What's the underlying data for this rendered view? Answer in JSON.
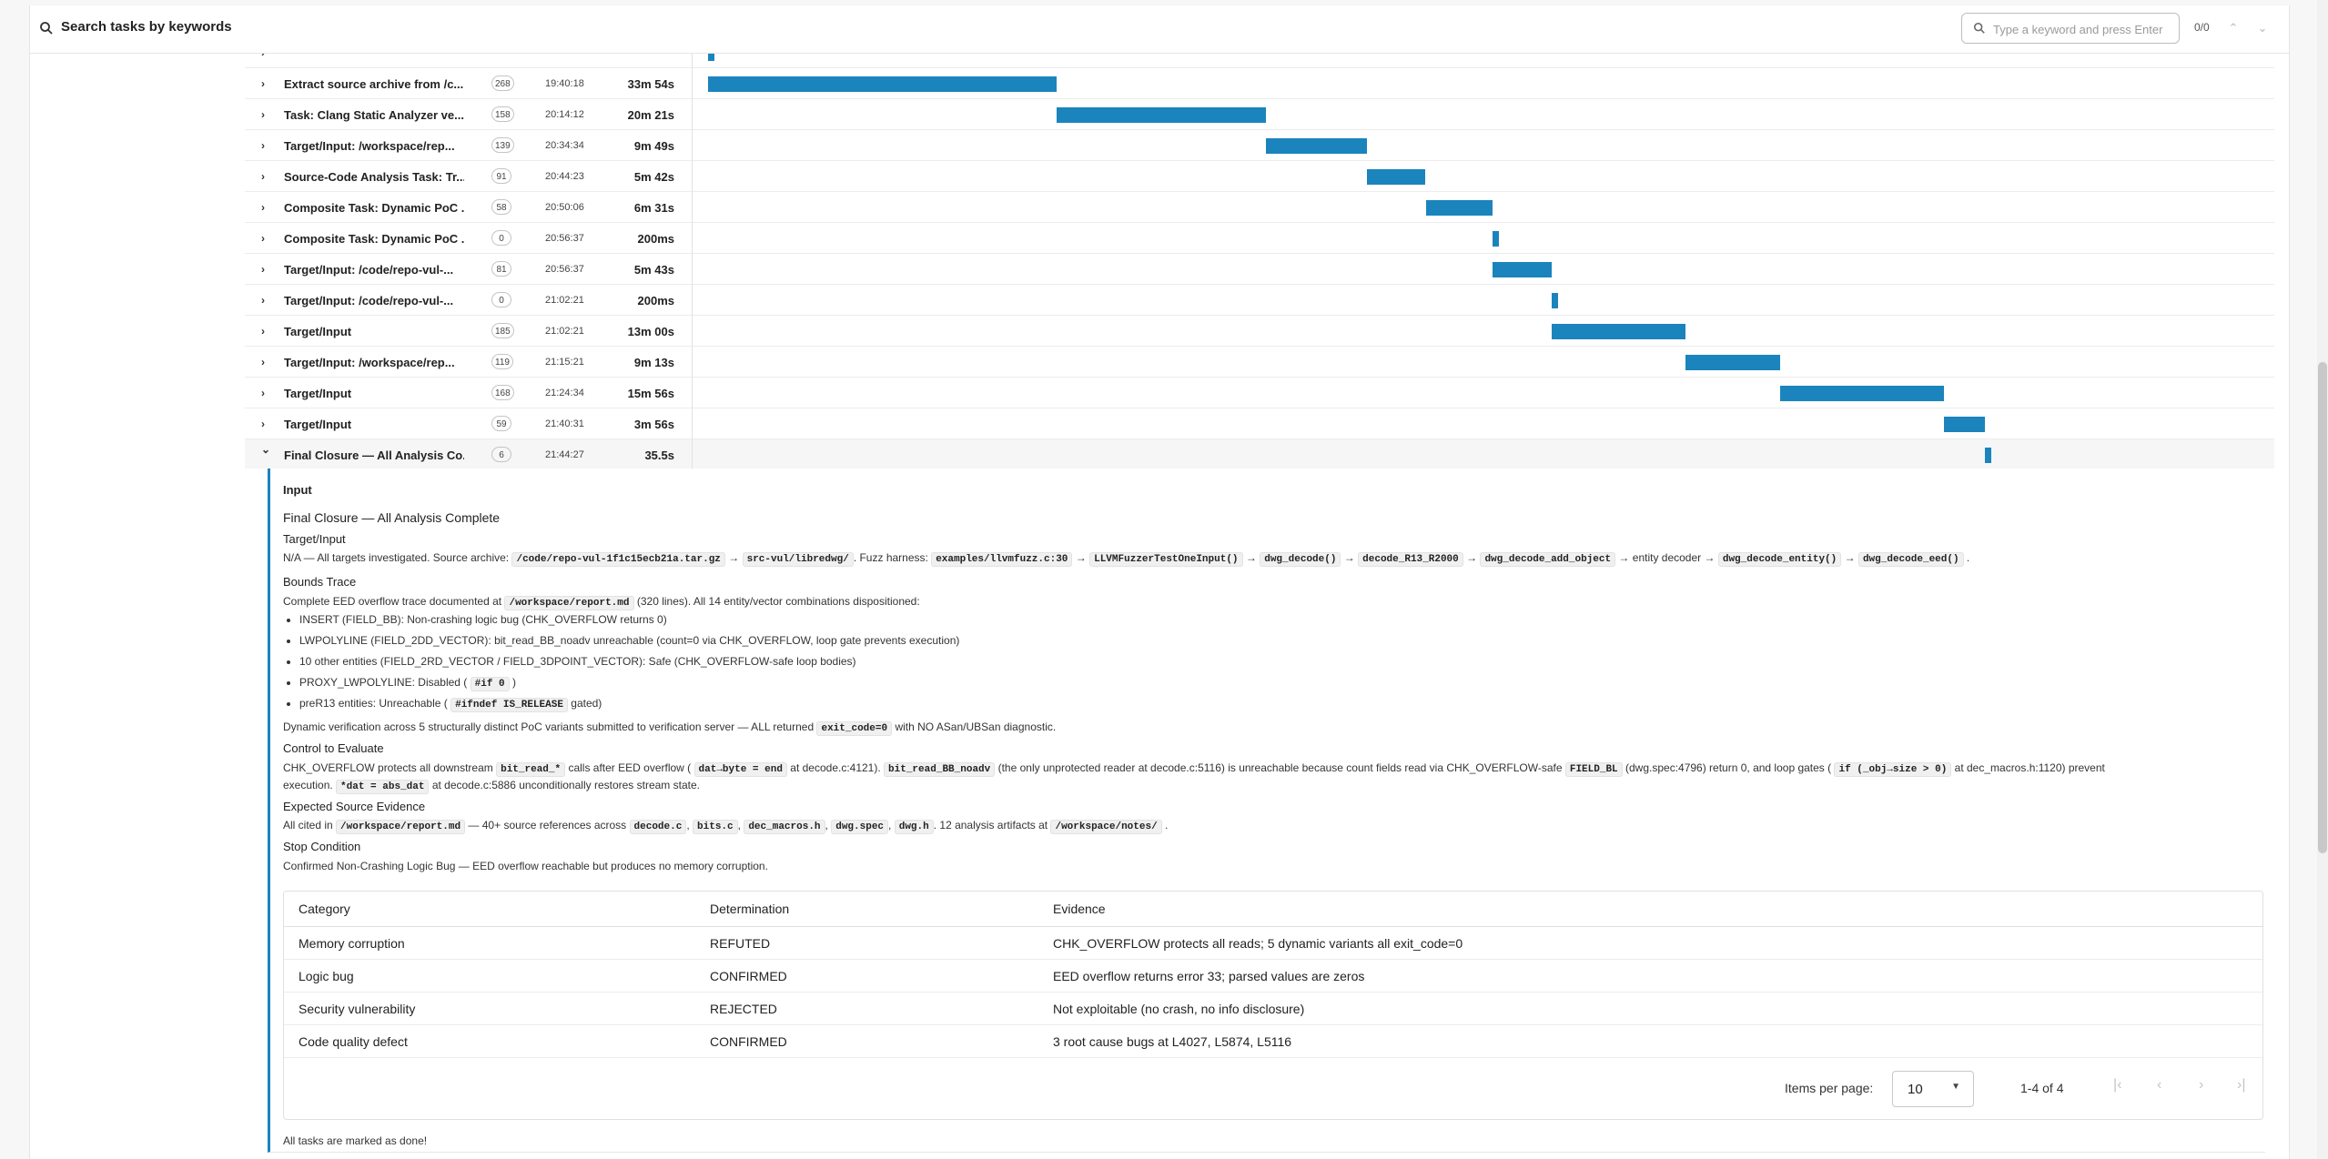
{
  "search": {
    "label": "Search tasks by keywords",
    "placeholder": "Type a keyword and press Enter",
    "count": "0/0"
  },
  "rows": [
    {
      "name": "",
      "badge": "",
      "time": "",
      "duration": "",
      "bar_start_min": 0,
      "bar_len_min": 0.2
    },
    {
      "name": "Extract source archive from /c...",
      "badge": "268",
      "time": "19:40:18",
      "duration": "33m 54s",
      "bar_start_min": 0,
      "bar_len_min": 33.9
    },
    {
      "name": "Task: Clang Static Analyzer ve...",
      "badge": "158",
      "time": "20:14:12",
      "duration": "20m 21s",
      "bar_start_min": 33.9,
      "bar_len_min": 20.35
    },
    {
      "name": "Target/Input: /workspace/rep...",
      "badge": "139",
      "time": "20:34:34",
      "duration": "9m 49s",
      "bar_start_min": 54.27,
      "bar_len_min": 9.82
    },
    {
      "name": "Source-Code Analysis Task: Tr...",
      "badge": "91",
      "time": "20:44:23",
      "duration": "5m 42s",
      "bar_start_min": 64.08,
      "bar_len_min": 5.7
    },
    {
      "name": "Composite Task: Dynamic PoC ...",
      "badge": "58",
      "time": "20:50:06",
      "duration": "6m 31s",
      "bar_start_min": 69.8,
      "bar_len_min": 6.52
    },
    {
      "name": "Composite Task: Dynamic PoC ...",
      "badge": "0",
      "time": "20:56:37",
      "duration": "200ms",
      "bar_start_min": 76.3,
      "bar_len_min": 0.003
    },
    {
      "name": "Target/Input: /code/repo-vul-...",
      "badge": "81",
      "time": "20:56:37",
      "duration": "5m 43s",
      "bar_start_min": 76.3,
      "bar_len_min": 5.72
    },
    {
      "name": "Target/Input: /code/repo-vul-...",
      "badge": "0",
      "time": "21:02:21",
      "duration": "200ms",
      "bar_start_min": 82.05,
      "bar_len_min": 0.003
    },
    {
      "name": "Target/Input",
      "badge": "185",
      "time": "21:02:21",
      "duration": "13m 00s",
      "bar_start_min": 82.05,
      "bar_len_min": 13.0
    },
    {
      "name": "Target/Input: /workspace/rep...",
      "badge": "119",
      "time": "21:15:21",
      "duration": "9m 13s",
      "bar_start_min": 95.05,
      "bar_len_min": 9.22
    },
    {
      "name": "Target/Input",
      "badge": "168",
      "time": "21:24:34",
      "duration": "15m 56s",
      "bar_start_min": 104.27,
      "bar_len_min": 15.93
    },
    {
      "name": "Target/Input",
      "badge": "59",
      "time": "21:40:31",
      "duration": "3m 56s",
      "bar_start_min": 120.22,
      "bar_len_min": 3.93
    },
    {
      "name": "Final Closure — All Analysis Co...",
      "badge": "6",
      "time": "21:44:27",
      "duration": "35.5s",
      "bar_start_min": 124.15,
      "bar_len_min": 0.59
    }
  ],
  "timeline_total_min": 154,
  "detail": {
    "input_heading": "Input",
    "title": "Final Closure — All Analysis Complete",
    "target_heading": "Target/Input",
    "target_line": {
      "t1": "N/A — All targets investigated. Source archive:",
      "c1": "/code/repo-vul-1f1c15ecb21a.tar.gz",
      "c2": "src-vul/libredwg/",
      "t2": ". Fuzz harness:",
      "c3": "examples/llvmfuzz.c:30",
      "c4": "LLVMFuzzerTestOneInput()",
      "c5": "dwg_decode()",
      "c6": "decode_R13_R2000",
      "c7": "dwg_decode_add_object",
      "t3": "entity decoder",
      "c8": "dwg_decode_entity()",
      "c9": "dwg_decode_eed()",
      "arrow": "→"
    },
    "bounds_heading": "Bounds Trace",
    "bounds_line": {
      "t1": "Complete EED overflow trace documented at",
      "c1": "/workspace/report.md",
      "t2": "(320 lines). All 14 entity/vector combinations dispositioned:"
    },
    "bullets": {
      "b1_strong": "INSERT",
      "b1_rest": " (FIELD_BB): Non-crashing logic bug (CHK_OVERFLOW returns 0)",
      "b2_strong": "LWPOLYLINE",
      "b2_rest": " (FIELD_2DD_VECTOR): bit_read_BB_noadv unreachable (count=0 via CHK_OVERFLOW, loop gate prevents execution)",
      "b3_strong": "10 other entities",
      "b3_rest": " (FIELD_2RD_VECTOR / FIELD_3DPOINT_VECTOR): Safe (CHK_OVERFLOW-safe loop bodies)",
      "b4_strong": "PROXY_LWPOLYLINE",
      "b4_rest": ": Disabled (",
      "b4_code": "#if 0",
      "b4_end": ")",
      "b5_strong": "preR13 entities",
      "b5_rest": ": Unreachable (",
      "b5_code": "#ifndef IS_RELEASE",
      "b5_end": " gated)"
    },
    "dynamic_line": {
      "t1": "Dynamic verification across 5 structurally distinct PoC variants submitted to verification server — ALL returned",
      "c1": "exit_code=0",
      "t2": "with NO ASan/UBSan diagnostic."
    },
    "control_heading": "Control to Evaluate",
    "control_line1": {
      "t1": "CHK_OVERFLOW protects all downstream",
      "c1": "bit_read_*",
      "t2": "calls after EED overflow (",
      "c2": "dat→byte = end",
      "t3": "at decode.c:4121).",
      "c3": "bit_read_BB_noadv",
      "t4": "(the only unprotected reader at decode.c:5116) is unreachable because count fields read via CHK_OVERFLOW-safe",
      "c4": "FIELD_BL",
      "t5": "(dwg.spec:4796) return 0, and loop gates (",
      "c5": "if (_obj→size > 0)",
      "t6": "at dec_macros.h:1120) prevent"
    },
    "control_line2": {
      "t1": "execution.",
      "c1": "*dat = abs_dat",
      "t2": "at decode.c:5886 unconditionally restores stream state."
    },
    "evidence_heading": "Expected Source Evidence",
    "evidence_line": {
      "t1": "All cited in",
      "c1": "/workspace/report.md",
      "t2": "— 40+ source references across",
      "c2": "decode.c",
      "c3": "bits.c",
      "c4": "dec_macros.h",
      "c5": "dwg.spec",
      "c6": "dwg.h",
      "t3": ". 12 analysis artifacts at",
      "c7": "/workspace/notes/",
      "comma": ",",
      "dot": "."
    },
    "stop_heading": "Stop Condition",
    "stop_line": "Confirmed Non-Crashing Logic Bug — EED overflow reachable but produces no memory corruption.",
    "table": {
      "headers": [
        "Category",
        "Determination",
        "Evidence"
      ],
      "rows": [
        [
          "Memory corruption",
          "REFUTED",
          "CHK_OVERFLOW protects all reads; 5 dynamic variants all exit_code=0"
        ],
        [
          "Logic bug",
          "CONFIRMED",
          "EED overflow returns error 33; parsed values are zeros"
        ],
        [
          "Security vulnerability",
          "REJECTED",
          "Not exploitable (no crash, no info disclosure)"
        ],
        [
          "Code quality defect",
          "CONFIRMED",
          "3 root cause bugs at L4027, L5874, L5116"
        ]
      ],
      "items_per_page_label": "Items per page:",
      "items_per_page_value": "10",
      "range": "1-4 of 4"
    },
    "done_text": "All tasks are marked as done!"
  },
  "colors": {
    "bar": "#1b84bd",
    "accent": "#1b84bd"
  }
}
